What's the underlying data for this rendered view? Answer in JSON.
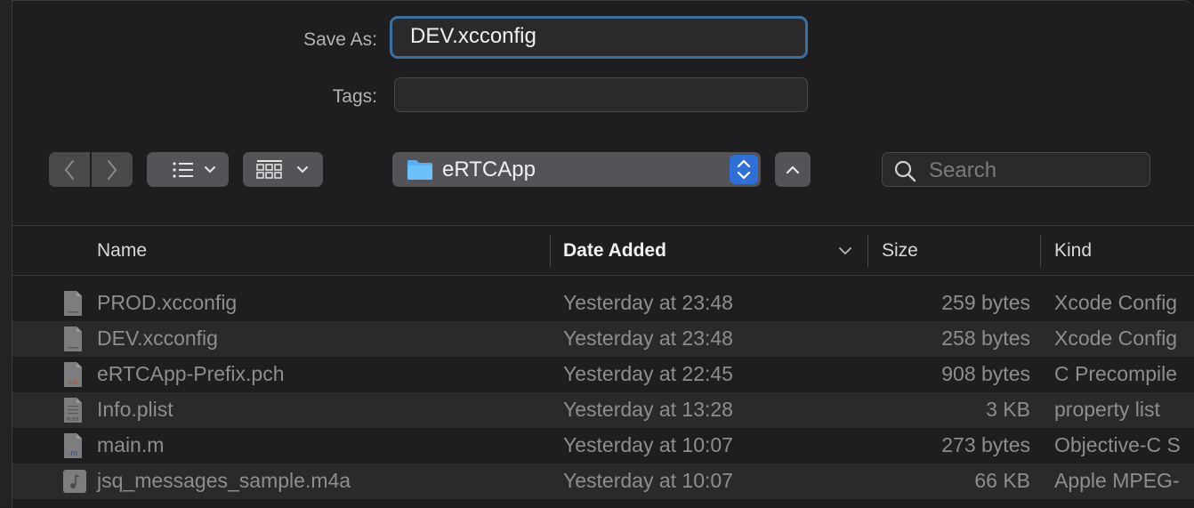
{
  "save_as": {
    "label": "Save As:",
    "value": "DEV.xcconfig"
  },
  "tags": {
    "label": "Tags:",
    "value": ""
  },
  "toolbar": {
    "location": "eRTCApp",
    "search_placeholder": "Search"
  },
  "columns": {
    "name": "Name",
    "date": "Date Added",
    "size": "Size",
    "kind": "Kind"
  },
  "files": [
    {
      "name": "PROD.xcconfig",
      "date": "Yesterday at 23:48",
      "size": "259 bytes",
      "kind": "Xcode Config",
      "icon": "document-icon"
    },
    {
      "name": "DEV.xcconfig",
      "date": "Yesterday at 23:48",
      "size": "258 bytes",
      "kind": "Xcode Config",
      "icon": "document-icon"
    },
    {
      "name": "eRTCApp-Prefix.pch",
      "date": "Yesterday at 22:45",
      "size": "908 bytes",
      "kind": "C Precompile",
      "icon": "pch-file-icon",
      "icon_text": "pch"
    },
    {
      "name": "Info.plist",
      "date": "Yesterday at 13:28",
      "size": "3 KB",
      "kind": "property list",
      "icon": "plist-file-icon",
      "icon_text": "PLIST"
    },
    {
      "name": "main.m",
      "date": "Yesterday at 10:07",
      "size": "273 bytes",
      "kind": "Objective-C S",
      "icon": "objc-file-icon",
      "icon_text": ".m"
    },
    {
      "name": "jsq_messages_sample.m4a",
      "date": "Yesterday at 10:07",
      "size": "66 KB",
      "kind": "Apple MPEG-",
      "icon": "audio-file-icon"
    }
  ]
}
